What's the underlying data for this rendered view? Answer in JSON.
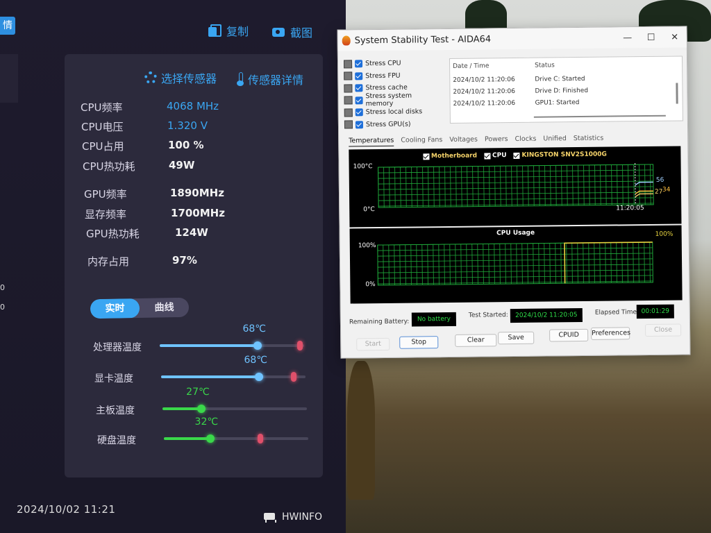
{
  "colors": {
    "accent_blue": "#3aa6f2",
    "marker_red": "#e0506a",
    "temp_blue": "#6fc3ff",
    "temp_green": "#3ad84a",
    "grid_green": "#1fa83a",
    "led_green": "#2fe04a",
    "cpu_line_yellow": "#e8d440"
  },
  "hwinfo": {
    "side_tab": "情",
    "side_mark_1": "0",
    "side_mark_2": "0",
    "copy_label": "复制",
    "screenshot_label": "截图",
    "select_sensor": "选择传感器",
    "sensor_detail": "传感器详情",
    "metrics": [
      {
        "label": "CPU频率",
        "value": "4068 MHz"
      },
      {
        "label": "CPU电压",
        "value": "1.320 V"
      },
      {
        "label": "CPU占用",
        "value": "100 %"
      },
      {
        "label": "CPU热功耗",
        "value": "49W"
      },
      {
        "label": "GPU频率",
        "value": "1890MHz"
      },
      {
        "label": "显存频率",
        "value": "1700MHz"
      },
      {
        "label": "GPU热功耗",
        "value": "124W"
      },
      {
        "label": "内存占用",
        "value": "97%"
      }
    ],
    "toggle": {
      "realtime": "实时",
      "curve": "曲线"
    },
    "temps": [
      {
        "label": "处理器温度",
        "value": "68℃",
        "level": 0.68,
        "color": "#6fc3ff",
        "marker": 0.95
      },
      {
        "label": "显卡温度",
        "value": "68℃",
        "level": 0.68,
        "color": "#6fc3ff",
        "marker": 0.9
      },
      {
        "label": "主板温度",
        "value": "27℃",
        "level": 0.27,
        "color": "#3ad84a"
      },
      {
        "label": "硬盘温度",
        "value": "32℃",
        "level": 0.32,
        "color": "#3ad84a",
        "marker": 0.65
      }
    ],
    "datetime": "2024/10/02 11:21",
    "brand": "HWINFO"
  },
  "aida": {
    "title": "System Stability Test - AIDA64",
    "win_buttons": [
      "—",
      "☐",
      "✕"
    ],
    "stress_items": [
      {
        "label": "Stress CPU",
        "icon": "cpu-icon"
      },
      {
        "label": "Stress FPU",
        "icon": "fpu-icon"
      },
      {
        "label": "Stress cache",
        "icon": "cache-icon"
      },
      {
        "label": "Stress system memory",
        "icon": "memory-icon"
      },
      {
        "label": "Stress local disks",
        "icon": "disk-icon"
      },
      {
        "label": "Stress GPU(s)",
        "icon": "gpu-icon"
      }
    ],
    "log": {
      "col_time": "Date / Time",
      "col_status": "Status",
      "rows": [
        {
          "time": "2024/10/2 11:20:06",
          "status": "Drive C: Started"
        },
        {
          "time": "2024/10/2 11:20:06",
          "status": "Drive D: Finished"
        },
        {
          "time": "2024/10/2 11:20:06",
          "status": "GPU1: Started"
        }
      ]
    },
    "tabs": [
      "Temperatures",
      "Cooling Fans",
      "Voltages",
      "Powers",
      "Clocks",
      "Unified",
      "Statistics"
    ],
    "temp_graph": {
      "legend": [
        {
          "label": "Motherboard",
          "color": "#f5d36a"
        },
        {
          "label": "CPU",
          "color": "#ffffff"
        },
        {
          "label": "KINGSTON SNV2S1000G",
          "color": "#f5d36a"
        }
      ],
      "y_top": "100°C",
      "y_bottom": "0°C",
      "time_label": "11:20:05",
      "series": [
        {
          "name": "Motherboard",
          "last": 27,
          "color": "#f5d36a"
        },
        {
          "name": "CPU",
          "last": 56,
          "color": "#9fd0ff"
        },
        {
          "name": "KINGSTON SNV2S1000G",
          "last": 34,
          "color": "#ffc040"
        }
      ],
      "value_labels": [
        "56",
        "27",
        "34"
      ]
    },
    "cpu_graph": {
      "title": "CPU Usage",
      "y_top": "100%",
      "y_bottom": "0%",
      "value_label": "100%",
      "step_at": 0.68
    },
    "bottom": {
      "battery_label": "Remaining Battery:",
      "battery_value": "No battery",
      "started_label": "Test Started:",
      "started_value": "2024/10/2 11:20:05",
      "elapsed_label": "Elapsed Time:",
      "elapsed_value": "00:01:29"
    },
    "buttons": {
      "start": "Start",
      "stop": "Stop",
      "clear": "Clear",
      "save": "Save",
      "cpuid": "CPUID",
      "preferences": "Preferences",
      "close": "Close"
    }
  }
}
